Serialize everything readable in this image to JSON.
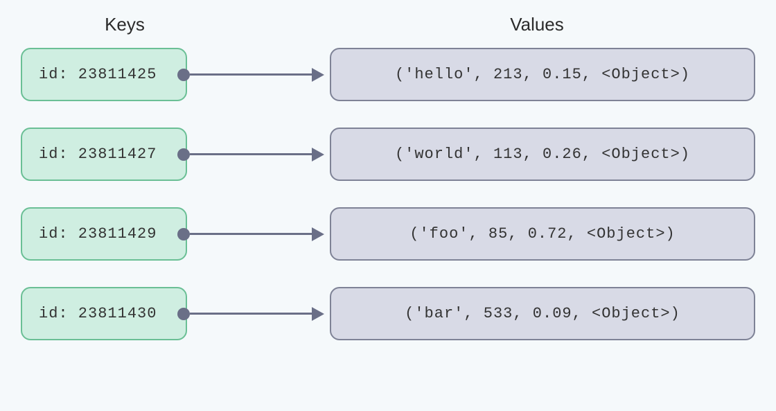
{
  "headers": {
    "keys": "Keys",
    "values": "Values"
  },
  "pairs": [
    {
      "key": "id: 23811425",
      "value": "('hello', 213, 0.15, <Object>)"
    },
    {
      "key": "id: 23811427",
      "value": "('world', 113, 0.26, <Object>)"
    },
    {
      "key": "id: 23811429",
      "value": "('foo', 85, 0.72, <Object>)"
    },
    {
      "key": "id: 23811430",
      "value": "('bar', 533, 0.09, <Object>)"
    }
  ]
}
